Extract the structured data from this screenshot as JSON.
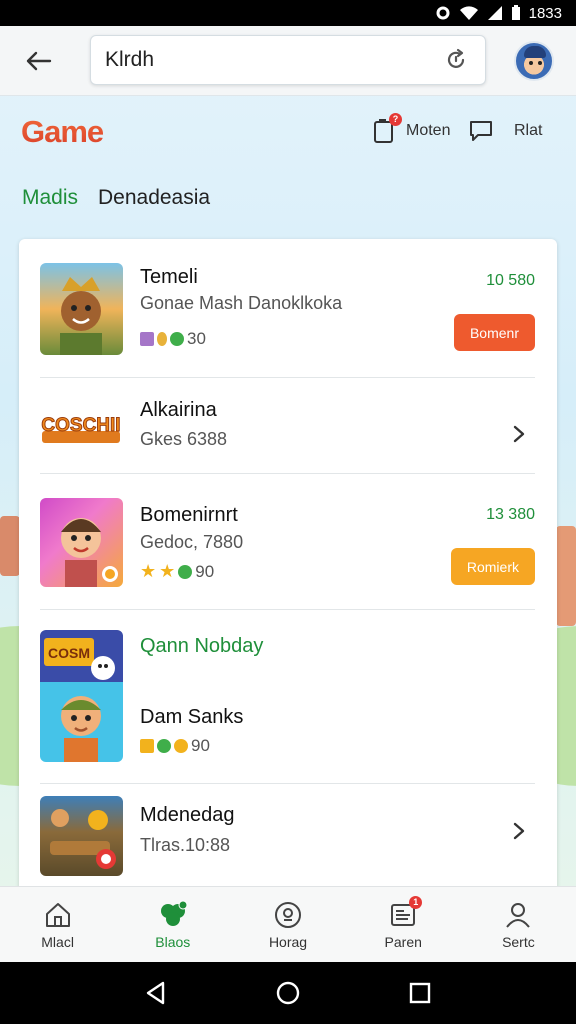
{
  "status_bar": {
    "time": "1833"
  },
  "search": {
    "value": "Klrdh"
  },
  "header": {
    "brand": "Game",
    "actions": [
      {
        "label": "Moten",
        "icon": "phone-notification-icon",
        "badge": "?"
      },
      {
        "label": "Rlat",
        "icon": "chat-bubble-icon"
      }
    ]
  },
  "tabs": [
    {
      "label": "Madis",
      "active": true
    },
    {
      "label": "Denadeasia",
      "active": false
    }
  ],
  "list": {
    "items": [
      {
        "title": "Temeli",
        "subtitle": "Gonae Mash Danoklkoka",
        "meta": "30",
        "price": "10 580",
        "button": "Bomenr",
        "button_color": "#ee5a2e"
      },
      {
        "title": "Alkairina",
        "subtitle": "Gkes 6388",
        "logo_text": "COSCHII"
      },
      {
        "title": "Bomenirnrt",
        "subtitle": "Gedoc, 7880",
        "meta": "90",
        "price": "13 380",
        "button": "Romierk",
        "button_color": "#f6a623"
      },
      {
        "header": "Qann Nobday",
        "title": "Dam Sanks",
        "meta": "90",
        "badge_text": "COSM"
      },
      {
        "title": "Mdenedag",
        "subtitle": "Tlras.10:88"
      }
    ]
  },
  "bottom_nav": [
    {
      "label": "Mlacl",
      "icon": "home-icon",
      "active": false
    },
    {
      "label": "Blaos",
      "icon": "clover-icon",
      "active": true
    },
    {
      "label": "Horag",
      "icon": "circle-badge-icon",
      "active": false
    },
    {
      "label": "Paren",
      "icon": "document-icon",
      "active": false,
      "badge": "1"
    },
    {
      "label": "Sertc",
      "icon": "person-icon",
      "active": false
    }
  ],
  "colors": {
    "accent": "#1f8f3a",
    "brand": "#e8502f"
  }
}
